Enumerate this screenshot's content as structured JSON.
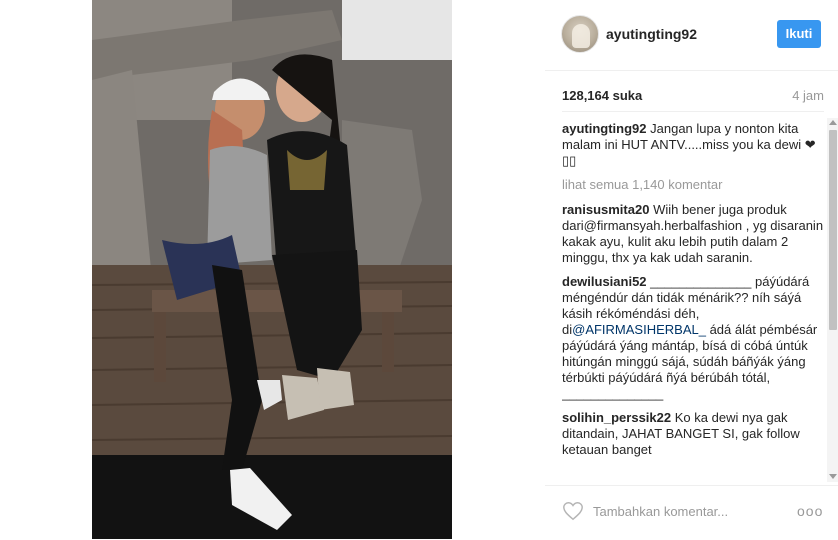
{
  "post": {
    "username": "ayutingting92",
    "follow_label": "Ikuti",
    "likes": "128,164 suka",
    "time": "4 jam",
    "caption": {
      "user": "ayutingting92",
      "text": "Jangan lupa y nonton kita malam ini HUT ANTV.....miss you ka dewi ❤▯▯"
    },
    "load_more": "lihat semua 1,140 komentar",
    "comments": [
      {
        "user": "ranisusmita20",
        "text": "Wiih bener juga produk dari@firmansyah.herbalfashion , yg disaranin kakak ayu, kulit aku lebih putih dalam 2 minggu, thx ya kak udah saranin."
      },
      {
        "user": "dewilusiani52",
        "text_before": "______________ páýúdárá méngéndúr dán tidák ménárik?? níh sáýá kásih rékóméndási déh, di",
        "mention": "@AFIRMASIHERBAL_",
        "text_after": " ádá álát pémbésár páýúdárá ýáng mántáp, bísá di cóbá úntúk hitúngán minggú sájá, súdáh báñýák ýáng térbúkti páýúdárá ñýá bérúbáh tótál, ______________"
      },
      {
        "user": "solihin_perssik22",
        "text": "Ko ka dewi nya gak ditandain, JAHAT BANGET SI, gak follow ketauan banget"
      }
    ],
    "add_comment_placeholder": "Tambahkan komentar...",
    "more_label": "ooo"
  },
  "icons": {
    "heart": "heart-icon",
    "more": "more-options-icon"
  },
  "colors": {
    "follow_button": "#3897f0",
    "mention": "#003569",
    "muted_text": "#999999"
  }
}
